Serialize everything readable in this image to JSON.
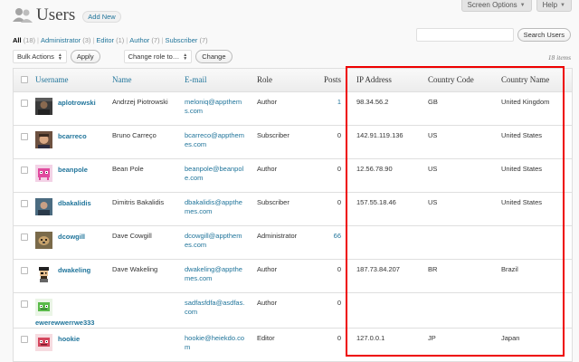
{
  "top_tabs": {
    "screen_options": "Screen Options",
    "help": "Help"
  },
  "header": {
    "title": "Users",
    "add_new": "Add New"
  },
  "filters": [
    {
      "label": "All",
      "count": "(18)",
      "current": true
    },
    {
      "label": "Administrator",
      "count": "(3)"
    },
    {
      "label": "Editor",
      "count": "(1)"
    },
    {
      "label": "Author",
      "count": "(7)"
    },
    {
      "label": "Subscriber",
      "count": "(7)"
    }
  ],
  "search": {
    "button": "Search Users",
    "value": ""
  },
  "toolbar": {
    "bulk_actions": "Bulk Actions",
    "apply": "Apply",
    "change_role": "Change role to…",
    "change": "Change"
  },
  "item_count": "18 items",
  "columns": {
    "username": "Username",
    "name": "Name",
    "email": "E-mail",
    "role": "Role",
    "posts": "Posts",
    "ip": "IP Address",
    "country_code": "Country Code",
    "country_name": "Country Name"
  },
  "rows": [
    {
      "username": "aplotrowski",
      "name": "Andrzej Piotrowski",
      "email_lines": [
        "meloniq@appthem",
        "s.com"
      ],
      "role": "Author",
      "posts": "1",
      "posts_link": true,
      "ip": "98.34.56.2",
      "cc": "GB",
      "country": "United Kingdom",
      "avatar": "photo-dark"
    },
    {
      "username": "bcarreco",
      "name": "Bruno Carreço",
      "email_lines": [
        "bcarreco@appthem",
        "es.com"
      ],
      "role": "Subscriber",
      "posts": "0",
      "posts_link": false,
      "ip": "142.91.119.136",
      "cc": "US",
      "country": "United States",
      "avatar": "photo-face"
    },
    {
      "username": "beanpole",
      "name": "Bean Pole",
      "email_lines": [
        "beanpole@beanpol",
        "e.com"
      ],
      "role": "Author",
      "posts": "0",
      "posts_link": false,
      "ip": "12.56.78.90",
      "cc": "US",
      "country": "United States",
      "avatar": "pink-invader"
    },
    {
      "username": "dbakalidis",
      "name": "Dimitris Bakalidis",
      "email_lines": [
        "dbakalidis@appthe",
        "mes.com"
      ],
      "role": "Subscriber",
      "posts": "0",
      "posts_link": false,
      "ip": "157.55.18.46",
      "cc": "US",
      "country": "United States",
      "avatar": "photo-blue"
    },
    {
      "username": "dcowgill",
      "name": "Dave Cowgill",
      "email_lines": [
        "dcowgill@appthem",
        "es.com"
      ],
      "role": "Administrator",
      "posts": "66",
      "posts_link": true,
      "ip": "",
      "cc": "",
      "country": "",
      "avatar": "photo-dog"
    },
    {
      "username": "dwakeling",
      "name": "Dave Wakeling",
      "email_lines": [
        "dwakeling@appthe",
        "mes.com"
      ],
      "role": "Author",
      "posts": "0",
      "posts_link": false,
      "ip": "187.73.84.207",
      "cc": "BR",
      "country": "Brazil",
      "avatar": "pirate"
    },
    {
      "username": "ewerewwerrwe333",
      "name": "",
      "email_lines": [
        "sadfasfdfa@asdfas.",
        "com"
      ],
      "role": "Author",
      "posts": "0",
      "posts_link": false,
      "ip": "",
      "cc": "",
      "country": "",
      "avatar": "green-invader",
      "stack": true
    },
    {
      "username": "hookie",
      "name": "",
      "email_lines": [
        "hookie@heiekdo.co",
        "m"
      ],
      "role": "Editor",
      "posts": "0",
      "posts_link": false,
      "ip": "127.0.0.1",
      "cc": "JP",
      "country": "Japan",
      "avatar": "red-invader"
    }
  ],
  "colors": {
    "link": "#21759b",
    "highlight": "#ee0000"
  }
}
